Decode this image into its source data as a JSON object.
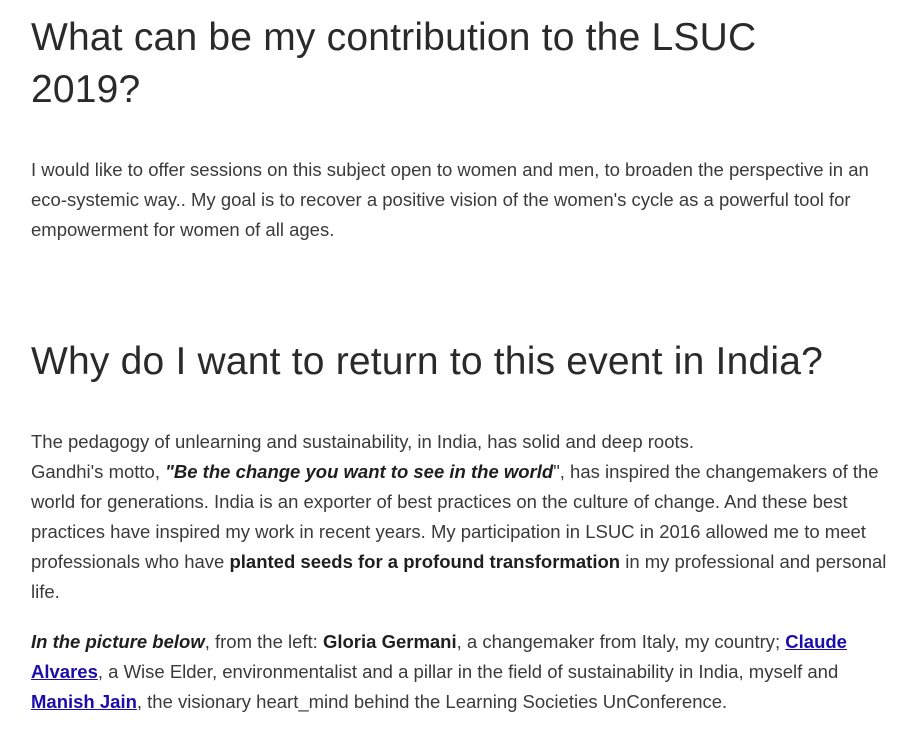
{
  "section1": {
    "heading_line1": "What can be my contribution to the LSUC",
    "heading_line2": "2019?",
    "paragraph": "I would like to offer sessions on this subject open to women and men, to broaden the perspective in an eco-systemic way.. My goal is to recover a positive vision of the women's cycle as a powerful tool for empowerment for women of all ages."
  },
  "section2": {
    "heading": "Why do I want to return to this event in India?",
    "p2_part1": "The pedagogy of unlearning and sustainability, in India, has solid and deep roots.",
    "p2_part2": "Gandhi's  motto, ",
    "p2_quote": "\"Be the change you want to see in the world",
    "p2_part3": "\", has inspired the changemakers of the world for generations. India is an exporter of best practices on the culture of change. And these best practices have inspired my work in recent years. My participation in LSUC in 2016 allowed me to meet professionals who have ",
    "p2_bold": "planted seeds for a profound transformation",
    "p2_part4": " in my professional and personal life.",
    "p3_intro": "In the picture below",
    "p3_part1": ", from the left: ",
    "p3_name1": "Gloria Germani",
    "p3_part2": ", a changemaker from Italy, my country; ",
    "p3_link1": "Claude Alvares",
    "p3_part3": ", a Wise Elder, environmentalist and a pillar in the field of sustainability in India, myself and ",
    "p3_link2": "Manish Jain",
    "p3_part4": ", the visionary heart_mind behind the Learning Societies UnConference."
  },
  "colors": {
    "text": "#3a3a3a",
    "heading": "#2a2a2a",
    "link": "#1a0dab",
    "background": "#ffffff"
  }
}
